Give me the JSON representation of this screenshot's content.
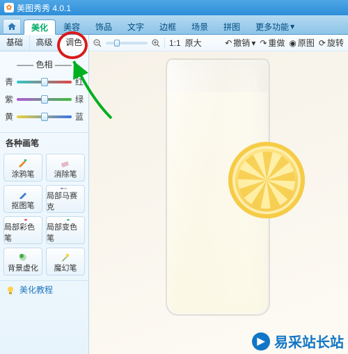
{
  "app": {
    "title": "美图秀秀 4.0.1"
  },
  "main_tabs": {
    "items": [
      "美化",
      "美容",
      "饰品",
      "文字",
      "边框",
      "场景",
      "拼图",
      "更多功能"
    ],
    "active_index": 0
  },
  "sub_tabs": {
    "items": [
      "基础",
      "高级",
      "调色"
    ],
    "active_index": 2
  },
  "sliders": {
    "title_label": "色相",
    "rows": [
      {
        "left": "青",
        "right": "红",
        "gradient": [
          "#2fc9c9",
          "#e24444"
        ],
        "value": 50
      },
      {
        "left": "紫",
        "right": "绿",
        "gradient": [
          "#b15ad8",
          "#3fbf3f"
        ],
        "value": 50
      },
      {
        "left": "黄",
        "right": "蓝",
        "gradient": [
          "#e9d23c",
          "#3c74e9"
        ],
        "value": 50
      }
    ]
  },
  "brushes": {
    "section_title": "各种画笔",
    "items": [
      {
        "label": "涂鸦笔",
        "icon": "doodle-pen-icon"
      },
      {
        "label": "消除笔",
        "icon": "eraser-icon"
      },
      {
        "label": "抠图笔",
        "icon": "cutout-pen-icon"
      },
      {
        "label": "局部马赛克",
        "icon": "mosaic-icon"
      },
      {
        "label": "局部彩色笔",
        "icon": "color-pen-icon"
      },
      {
        "label": "局部变色笔",
        "icon": "recolor-pen-icon"
      },
      {
        "label": "背景虚化",
        "icon": "blur-bg-icon"
      },
      {
        "label": "魔幻笔",
        "icon": "magic-pen-icon"
      }
    ]
  },
  "tutorial": {
    "label": "美化教程"
  },
  "toolbar": {
    "zoom_out": "−",
    "zoom_in": "+",
    "ratio_label": "1:1",
    "orig_label": "原大",
    "undo_label": "撤销",
    "redo_label": "重做",
    "original_label": "原图",
    "rotate_label": "旋转"
  },
  "canvas": {
    "subject": "glass-of-lemon-water"
  },
  "watermark": {
    "text": "易采站长站"
  },
  "colors": {
    "accent": "#2d8ed8",
    "annot_red": "#d81b1b",
    "annot_green": "#00b020"
  }
}
